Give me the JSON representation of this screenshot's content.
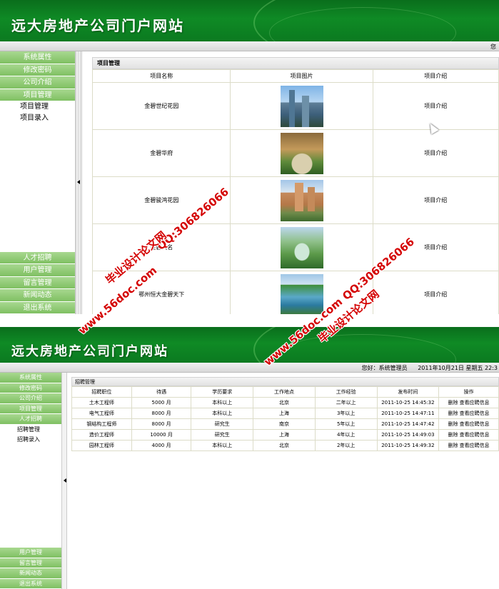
{
  "site_title": "远大房地产公司门户网站",
  "screen1": {
    "greeting_fragment": "您",
    "menu_top": [
      {
        "label": "系统属性"
      },
      {
        "label": "修改密码"
      },
      {
        "label": "公司介绍"
      },
      {
        "label": "项目管理"
      }
    ],
    "submenu": [
      {
        "label": "项目管理"
      },
      {
        "label": "项目录入"
      }
    ],
    "menu_bottom": [
      {
        "label": "人才招聘"
      },
      {
        "label": "用户管理"
      },
      {
        "label": "留言管理"
      },
      {
        "label": "新闻动态"
      },
      {
        "label": "退出系统"
      }
    ],
    "panel_title": "项目管理",
    "columns": [
      "项目名称",
      "项目图片",
      "项目介绍"
    ],
    "rows": [
      {
        "name": "金碧世纪花园",
        "intro": "项目介绍",
        "image": "tower-photo"
      },
      {
        "name": "金碧华府",
        "intro": "项目介绍",
        "image": "courtyard-photo"
      },
      {
        "name": "金碧骏鸿花园",
        "intro": "项目介绍",
        "image": "apartment-photo"
      },
      {
        "name": "金碧大名",
        "intro": "项目介绍",
        "image": "aerial-photo"
      },
      {
        "name": "鄂州恒大金碧天下",
        "intro": "项目介绍",
        "image": "lakeside-photo"
      }
    ]
  },
  "screen2": {
    "greeting": "您好：系统管理员",
    "date": "2011年10月21日 星期五 22:3",
    "menu_top": [
      {
        "label": "系统属性"
      },
      {
        "label": "修改密码"
      },
      {
        "label": "公司介绍"
      },
      {
        "label": "项目管理"
      },
      {
        "label": "人才招聘"
      }
    ],
    "submenu": [
      {
        "label": "招聘管理"
      },
      {
        "label": "招聘录入"
      }
    ],
    "menu_bottom": [
      {
        "label": "用户管理"
      },
      {
        "label": "留言管理"
      },
      {
        "label": "新闻动态"
      },
      {
        "label": "退出系统"
      }
    ],
    "panel_title": "招聘管理",
    "columns": [
      "招聘职位",
      "待遇",
      "学历要求",
      "工作地点",
      "工作经验",
      "发布时间",
      "操作"
    ],
    "rows": [
      {
        "position": "土木工程师",
        "salary": "5000 月",
        "education": "本科以上",
        "location": "北京",
        "experience": "二年以上",
        "time": "2011-10-25 14:45:32",
        "delete": "删除",
        "view": "查看应聘信息"
      },
      {
        "position": "电气工程师",
        "salary": "8000 月",
        "education": "本科以上",
        "location": "上海",
        "experience": "3年以上",
        "time": "2011-10-25 14:47:11",
        "delete": "删除",
        "view": "查看应聘信息"
      },
      {
        "position": "钢结构工程师",
        "salary": "8000 月",
        "education": "研究生",
        "location": "南京",
        "experience": "5年以上",
        "time": "2011-10-25 14:47:42",
        "delete": "删除",
        "view": "查看应聘信息"
      },
      {
        "position": "造价工程师",
        "salary": "10000 月",
        "education": "研究生",
        "location": "上海",
        "experience": "4年以上",
        "time": "2011-10-25 14:49:03",
        "delete": "删除",
        "view": "查看应聘信息"
      },
      {
        "position": "园林工程师",
        "salary": "4000 月",
        "education": "本科以上",
        "location": "北京",
        "experience": "2年以上",
        "time": "2011-10-25 14:49:32",
        "delete": "删除",
        "view": "查看应聘信息"
      }
    ]
  },
  "watermarks": {
    "site": "www.56doc.com",
    "qq": "QQ:306826066",
    "slogan": "毕业设计论文网"
  },
  "colors": {
    "banner_green": "#0f8a25",
    "menu_green": "#8cc870",
    "watermark_red": "#d40000"
  }
}
